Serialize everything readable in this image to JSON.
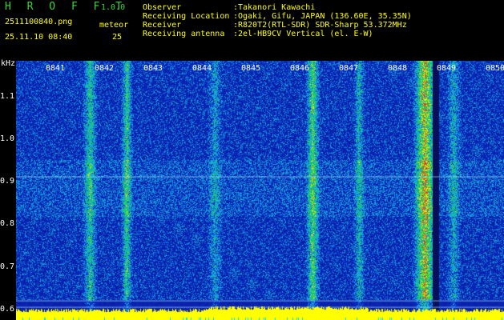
{
  "header": {
    "app_title": "H R O F F T",
    "app_version": "1.0.0",
    "file_name": "2511100840.png",
    "date_time": "25.11.10 08:40",
    "meteor_label": "meteor",
    "meteor_count": "25",
    "info": [
      {
        "key": "Observer",
        "sep": ":",
        "value": "Takanori Kawachi"
      },
      {
        "key": "Receiving Location",
        "sep": ":",
        "value": "Ogaki, Gifu, JAPAN (136.60E, 35.35N)"
      },
      {
        "key": "Receiver",
        "sep": ":",
        "value": "R820T2(RTL-SDR) SDR-Sharp 53.372MHz"
      },
      {
        "key": "Receiving antenna",
        "sep": ":",
        "value": "2el-HB9CV Vertical (el. E-W)"
      }
    ]
  },
  "chart_data": {
    "type": "heatmap",
    "ylabel": "kHz",
    "y_ticks": [
      "1.1",
      "1.0",
      "0.9",
      "0.8",
      "0.7",
      "0.6"
    ],
    "y_values": [
      1.1,
      1.0,
      0.9,
      0.8,
      0.7,
      0.6
    ],
    "ylim": [
      0.575,
      1.185
    ],
    "x_ticks": [
      "0841",
      "0842",
      "0843",
      "0844",
      "0845",
      "0846",
      "0847",
      "0848",
      "0849",
      "0850"
    ],
    "xlim_minutes": [
      "0840",
      "0850"
    ],
    "colors": {
      "background": "#0a1a9a",
      "noise": "#1e50d8",
      "cyan": "#00e0ff",
      "green": "#20e020",
      "yellow": "#ffff00",
      "red": "#ff2020",
      "baseline": "#ffff00"
    }
  }
}
